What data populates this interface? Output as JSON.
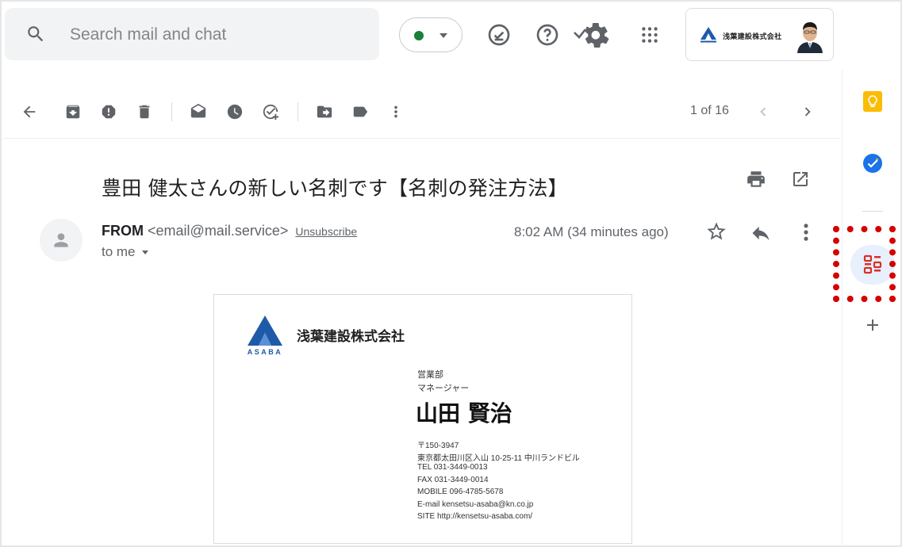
{
  "search": {
    "placeholder": "Search mail and chat"
  },
  "header": {
    "status_color": "#188038",
    "account_company": "浅葉建設株式会社"
  },
  "toolbar": {
    "pager": "1 of 16"
  },
  "email": {
    "subject": "豊田 健太さんの新しい名刺です【名刺の発注方法】",
    "from_name": "FROM",
    "from_email": "<email@mail.service>",
    "unsubscribe": "Unsubscribe",
    "recipient": "to me",
    "time": "8:02 AM (34 minutes ago)"
  },
  "card": {
    "logo_text": "ASABA",
    "company": "浅葉建設株式会社",
    "department": "営業部",
    "title": "マネージャー",
    "name": "山田 賢治",
    "lines": [
      "〒150-3947",
      "東京都太田川区入山 10-25-11 中川ランドビル",
      "TEL 031-3449-0013",
      "FAX 031-3449-0014",
      "MOBILE 096-4785-5678",
      "E-mail kensetsu-asaba@kn.co.jp",
      "SITE http://kensetsu-asaba.com/"
    ]
  },
  "colors": {
    "accent_blue": "#1a73e8",
    "keep_yellow": "#fbbc04",
    "highlight_red": "#d50000"
  }
}
